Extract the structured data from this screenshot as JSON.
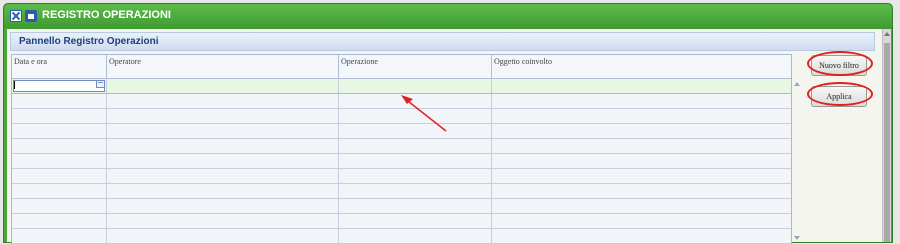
{
  "window": {
    "title": "REGISTRO OPERAZIONI",
    "close_icon": "close-icon",
    "maximize_icon": "maximize-icon"
  },
  "panel": {
    "title": "Pannello Registro Operazioni"
  },
  "table": {
    "columns": [
      {
        "label": "Data e ora"
      },
      {
        "label": "Operatore"
      },
      {
        "label": "Operazione"
      },
      {
        "label": "Oggetto coinvolto"
      }
    ],
    "rows": [
      {
        "data_ora": "",
        "operatore": "",
        "operazione": "",
        "oggetto": ""
      },
      {
        "data_ora": "",
        "operatore": "",
        "operazione": "",
        "oggetto": ""
      },
      {
        "data_ora": "",
        "operatore": "",
        "operazione": "",
        "oggetto": ""
      },
      {
        "data_ora": "",
        "operatore": "",
        "operazione": "",
        "oggetto": ""
      },
      {
        "data_ora": "",
        "operatore": "",
        "operazione": "",
        "oggetto": ""
      },
      {
        "data_ora": "",
        "operatore": "",
        "operazione": "",
        "oggetto": ""
      },
      {
        "data_ora": "",
        "operatore": "",
        "operazione": "",
        "oggetto": ""
      },
      {
        "data_ora": "",
        "operatore": "",
        "operazione": "",
        "oggetto": ""
      },
      {
        "data_ora": "",
        "operatore": "",
        "operazione": "",
        "oggetto": ""
      },
      {
        "data_ora": "",
        "operatore": "",
        "operazione": "",
        "oggetto": ""
      },
      {
        "data_ora": "",
        "operatore": "",
        "operazione": "",
        "oggetto": ""
      }
    ],
    "filter_row": {
      "date_value": ""
    }
  },
  "buttons": {
    "new_filter": "Nuovo filtro",
    "apply": "Applica"
  },
  "colors": {
    "window_green": "#4aa83b",
    "annotation_red": "#e02020",
    "selected_row": "#e6f7e3"
  }
}
